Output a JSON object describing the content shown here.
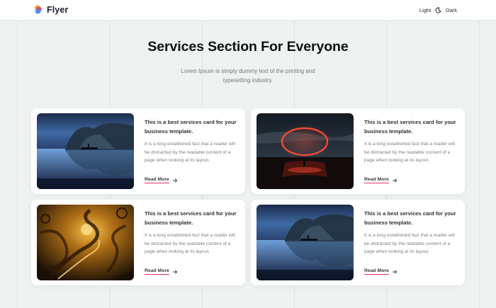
{
  "header": {
    "brand": "Flyer",
    "theme_light": "Light",
    "theme_dark": "Dark",
    "logo_icon": "flyer-logo-icon",
    "theme_icon": "moon-icon"
  },
  "hero": {
    "title": "Services Section For Everyone",
    "subtitle": "Lorem Ipsum is simply dummy text of the printing and typesetting industry."
  },
  "cards": [
    {
      "image": "lake-boat-night-image",
      "title": "This is a best services card for your business template.",
      "text": "It is a long established fact that a reader will be distracted by the readable content of a page when looking at its layout.",
      "link": "Read More"
    },
    {
      "image": "red-ring-night-image",
      "title": "This is a best services card for your business template.",
      "text": "It is a long established fact that a reader will be distracted by the readable content of a page when looking at its layout.",
      "link": "Read More"
    },
    {
      "image": "golden-swirl-image",
      "title": "This is a best services card for your business template.",
      "text": "It is a long established fact that a reader will be distracted by the readable content of a page when looking at its layout.",
      "link": "Read More"
    },
    {
      "image": "lake-boat-night-image",
      "title": "This is a best services card for your business template.",
      "text": "It is a long established fact that a reader will be distracted by the readable content of a page when looking at its layout.",
      "link": "Read More"
    }
  ],
  "colors": {
    "accent": "#e5306c",
    "background": "#eef3f1"
  }
}
